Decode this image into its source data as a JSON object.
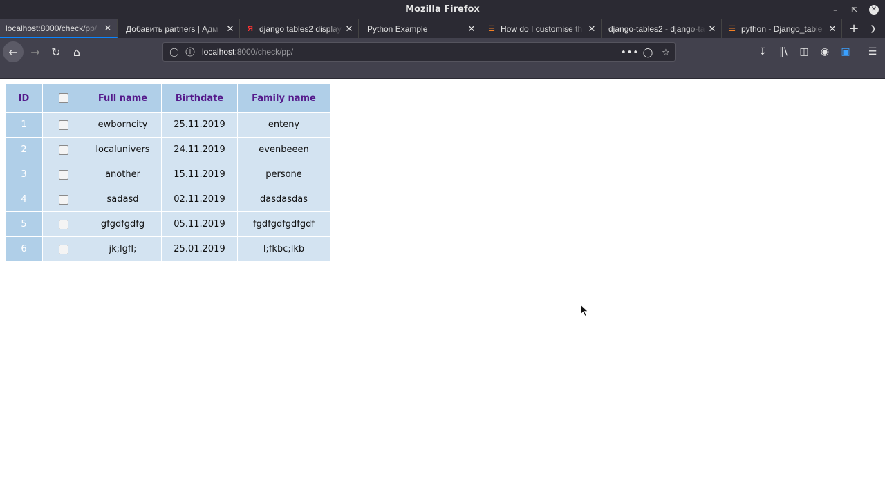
{
  "window": {
    "title": "Mozilla Firefox"
  },
  "tabs": [
    {
      "label": "localhost:8000/check/pp/",
      "favicon": "none"
    },
    {
      "label": "Добавить partners | Адм",
      "favicon": "none"
    },
    {
      "label": "django tables2 display",
      "favicon": "yandex-icon"
    },
    {
      "label": "Python Example",
      "favicon": "none"
    },
    {
      "label": "How do I customise th",
      "favicon": "stackoverflow-icon"
    },
    {
      "label": "django-tables2 - django-ta",
      "favicon": "none"
    },
    {
      "label": "python - Django_table",
      "favicon": "stackoverflow-icon"
    }
  ],
  "address_bar": {
    "host": "localhost",
    "path": ":8000/check/pp/"
  },
  "table": {
    "headers": {
      "id": "ID",
      "full_name": "Full name",
      "birthdate": "Birthdate",
      "family_name": "Family name"
    },
    "rows": [
      {
        "id": "1",
        "full_name": "ewborncity",
        "birthdate": "25.11.2019",
        "family_name": "enteny"
      },
      {
        "id": "2",
        "full_name": "localunivers",
        "birthdate": "24.11.2019",
        "family_name": "evenbeeen"
      },
      {
        "id": "3",
        "full_name": "another",
        "birthdate": "15.11.2019",
        "family_name": "persone"
      },
      {
        "id": "4",
        "full_name": "sadasd",
        "birthdate": "02.11.2019",
        "family_name": "dasdasdas"
      },
      {
        "id": "5",
        "full_name": "gfgdfgdfg",
        "birthdate": "05.11.2019",
        "family_name": "fgdfgdfgdfgdf"
      },
      {
        "id": "6",
        "full_name": "jk;lgfl;",
        "birthdate": "25.01.2019",
        "family_name": "l;fkbc;lkb"
      }
    ]
  },
  "colors": {
    "header_bg": "#b0cfe8",
    "row_bg": "#d3e3f1",
    "link": "#551a8b",
    "accent": "#0a84ff"
  }
}
